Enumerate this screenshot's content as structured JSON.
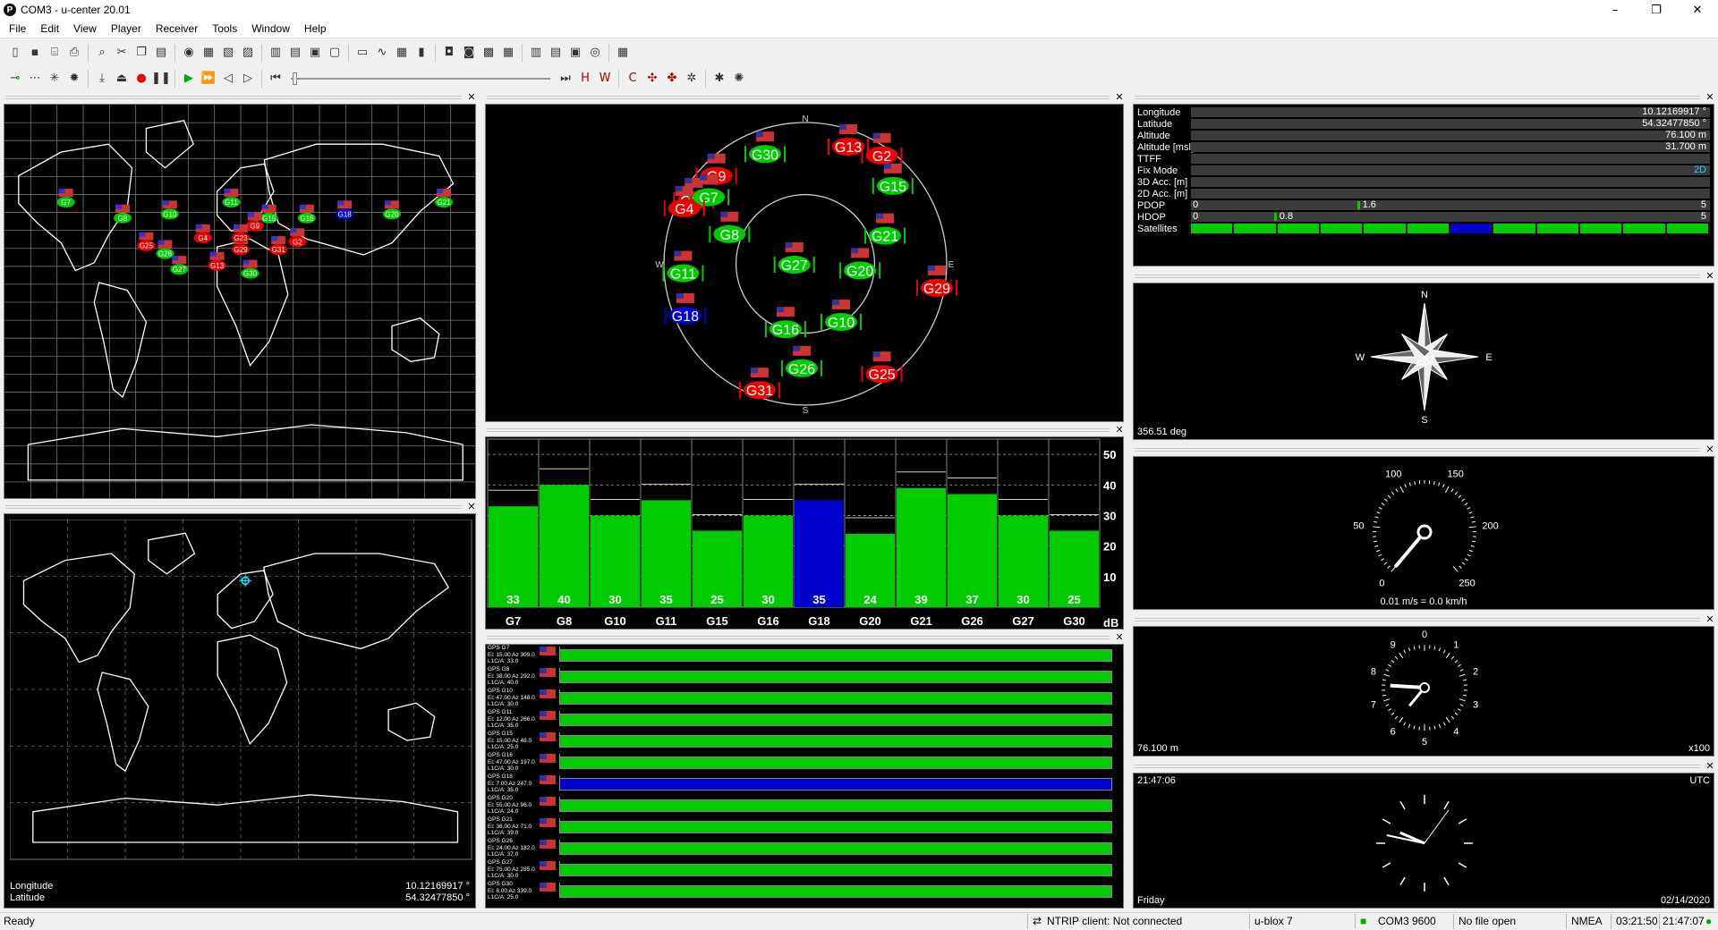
{
  "window": {
    "title": "COM3 - u-center 20.01",
    "app_icon": "P"
  },
  "menu": [
    "File",
    "Edit",
    "View",
    "Player",
    "Receiver",
    "Tools",
    "Window",
    "Help"
  ],
  "toolbar1": [
    "new-icon",
    "save-icon",
    "open-icon",
    "print-icon",
    "preview-icon",
    "cut-icon",
    "copy-icon",
    "paste-icon",
    "record-icon",
    "doc1-icon",
    "doc2-icon",
    "doc3-icon",
    "layout1-icon",
    "layout2-icon",
    "layout3-icon",
    "layout4-icon",
    "chart-icon",
    "graph-icon",
    "table-icon",
    "signal-icon",
    "camera-icon",
    "msg1-icon",
    "msg2-icon",
    "msg3-icon",
    "msg4-icon",
    "msg5-icon",
    "msg6-icon",
    "msg7-icon",
    "msg8-icon"
  ],
  "toolbar2": [
    "connect-icon",
    "baud-icon",
    "autobaud-icon",
    "settings-icon",
    "download-icon",
    "eject-icon",
    "rec-icon",
    "pause-icon",
    "play-icon",
    "fast-icon",
    "back-icon",
    "step-fwd-icon",
    "step-back-icon",
    "end-icon",
    "h-icon",
    "w-icon",
    "c-icon",
    "gnss1-icon",
    "gnss2-icon",
    "cfg1-icon",
    "cfg2-icon",
    "cfg3-icon"
  ],
  "map1": {
    "satellites": [
      "G7",
      "G8",
      "G10",
      "G11",
      "G15",
      "G16",
      "G18",
      "G20",
      "G21",
      "G26",
      "G27",
      "G29",
      "G30",
      "G31",
      "G9",
      "G13",
      "G2",
      "G23",
      "G4",
      "G25"
    ]
  },
  "map2": {
    "longitude_label": "Longitude",
    "longitude": "10.12169917 °",
    "latitude_label": "Latitude",
    "latitude": "54.32477850 °"
  },
  "sky": {
    "north": "N",
    "east": "E",
    "south": "S",
    "west": "W",
    "sats": [
      {
        "id": "G30",
        "az": 340,
        "el": 15,
        "color": "#0c0"
      },
      {
        "id": "G13",
        "az": 20,
        "el": 10,
        "color": "#e00"
      },
      {
        "id": "G2",
        "az": 35,
        "el": 5,
        "color": "#e00"
      },
      {
        "id": "G9",
        "az": 315,
        "el": 10,
        "color": "#e00"
      },
      {
        "id": "G23",
        "az": 300,
        "el": 8,
        "color": "#e00"
      },
      {
        "id": "G7",
        "az": 305,
        "el": 15,
        "color": "#0c0"
      },
      {
        "id": "G4",
        "az": 295,
        "el": 5,
        "color": "#e00"
      },
      {
        "id": "G15",
        "az": 48,
        "el": 15,
        "color": "#0c0"
      },
      {
        "id": "G8",
        "az": 292,
        "el": 38,
        "color": "#0c0"
      },
      {
        "id": "G21",
        "az": 70,
        "el": 36,
        "color": "#0c0"
      },
      {
        "id": "G27",
        "az": 270,
        "el": 83,
        "color": "#0c0"
      },
      {
        "id": "G20",
        "az": 96,
        "el": 55,
        "color": "#0c0"
      },
      {
        "id": "G11",
        "az": 266,
        "el": 12,
        "color": "#0c0"
      },
      {
        "id": "G29",
        "az": 100,
        "el": 5,
        "color": "#e00"
      },
      {
        "id": "G18",
        "az": 247,
        "el": 7,
        "color": "#00c"
      },
      {
        "id": "G10",
        "az": 148,
        "el": 47,
        "color": "#0c0"
      },
      {
        "id": "G16",
        "az": 197,
        "el": 47,
        "color": "#0c0"
      },
      {
        "id": "G26",
        "az": 182,
        "el": 24,
        "color": "#0c0"
      },
      {
        "id": "G25",
        "az": 145,
        "el": 5,
        "color": "#e00"
      },
      {
        "id": "G31",
        "az": 200,
        "el": 5,
        "color": "#e00"
      }
    ]
  },
  "chart_data": {
    "type": "bar",
    "categories": [
      "G7",
      "G8",
      "G10",
      "G11",
      "G15",
      "G16",
      "G18",
      "G20",
      "G21",
      "G26",
      "G27",
      "G30"
    ],
    "values": [
      33,
      40,
      30,
      35,
      25,
      30,
      35,
      24,
      39,
      37,
      30,
      25
    ],
    "colors": [
      "#0c0",
      "#0c0",
      "#0c0",
      "#0c0",
      "#0c0",
      "#0c0",
      "#00c",
      "#0c0",
      "#0c0",
      "#0c0",
      "#0c0",
      "#0c0"
    ],
    "yticks": [
      10,
      20,
      30,
      40,
      50
    ],
    "unit": "dB",
    "ylim": [
      0,
      55
    ]
  },
  "sigtable": [
    {
      "l1": "GPS G7",
      "l2": "El: 15.00 Az 309.0",
      "l3": "L1C/A: 33.0",
      "color": "#0c0"
    },
    {
      "l1": "GPS G8",
      "l2": "El: 38.00 Az 292.0",
      "l3": "L1C/A: 40.0",
      "color": "#0c0"
    },
    {
      "l1": "GPS G10",
      "l2": "El: 47.00 Az 148.0",
      "l3": "L1C/A: 30.0",
      "color": "#0c0"
    },
    {
      "l1": "GPS G11",
      "l2": "El: 12.00 Az 266.0",
      "l3": "L1C/A: 35.0",
      "color": "#0c0"
    },
    {
      "l1": "GPS G15",
      "l2": "El: 15.00 Az 48.0",
      "l3": "L1C/A: 25.0",
      "color": "#0c0"
    },
    {
      "l1": "GPS G16",
      "l2": "El: 47.00 Az 197.0",
      "l3": "L1C/A: 30.0",
      "color": "#0c0"
    },
    {
      "l1": "GPS G18",
      "l2": "El: 7.00 Az 247.0",
      "l3": "L1C/A: 35.0",
      "color": "#00c"
    },
    {
      "l1": "GPS G20",
      "l2": "El: 55.00 Az 96.0",
      "l3": "L1C/A: 24.0",
      "color": "#0c0"
    },
    {
      "l1": "GPS G21",
      "l2": "El: 36.00 Az 71.0",
      "l3": "L1C/A: 39.0",
      "color": "#0c0"
    },
    {
      "l1": "GPS G26",
      "l2": "El: 24.00 Az 182.0",
      "l3": "L1C/A: 37.0",
      "color": "#0c0"
    },
    {
      "l1": "GPS G27",
      "l2": "El: 75.00 Az 285.0",
      "l3": "L1C/A: 30.0",
      "color": "#0c0"
    },
    {
      "l1": "GPS G30",
      "l2": "El: 8.00 Az 339.0",
      "l3": "L1C/A: 25.0",
      "color": "#0c0"
    }
  ],
  "data": {
    "longitude_label": "Longitude",
    "longitude": "10.12169917 °",
    "latitude_label": "Latitude",
    "latitude": "54.32477850 °",
    "altitude_label": "Altitude",
    "altitude": "76.100 m",
    "altitude_msl_label": "Altitude [msl]",
    "altitude_msl": "31.700 m",
    "ttff_label": "TTFF",
    "ttff": "",
    "fixmode_label": "Fix Mode",
    "fixmode": "2D",
    "acc3d_label": "3D Acc. [m]",
    "acc3d": "",
    "acc2d_label": "2D Acc. [m]",
    "acc2d": "",
    "pdop_label": "PDOP",
    "pdop_min": "0",
    "pdop": "1.6",
    "pdop_max": "5",
    "pdop_fraction": 0.32,
    "hdop_label": "HDOP",
    "hdop_min": "0",
    "hdop": "0.8",
    "hdop_max": "5",
    "hdop_fraction": 0.16,
    "satellites_label": "Satellites",
    "satellite_colors": [
      "#0c0",
      "#0c0",
      "#0c0",
      "#0c0",
      "#0c0",
      "#0c0",
      "#00c",
      "#0c0",
      "#0c0",
      "#0c0",
      "#0c0",
      "#0c0"
    ]
  },
  "compass": {
    "n": "N",
    "e": "E",
    "s": "S",
    "w": "W",
    "heading": "356.51 deg"
  },
  "speedo": {
    "ticks": [
      "0",
      "50",
      "100",
      "150",
      "200",
      "250"
    ],
    "reading": "0.01 m/s = 0.0 km/h"
  },
  "altimeter": {
    "ticks": [
      "0",
      "1",
      "2",
      "3",
      "4",
      "5",
      "6",
      "7",
      "8",
      "9"
    ],
    "reading": "76.100 m",
    "scale": "x100"
  },
  "clock": {
    "time": "21:47:06",
    "zone": "UTC",
    "day": "Friday",
    "date": "02/14/2020"
  },
  "status": {
    "ready": "Ready",
    "ntrip": "NTRIP client: Not connected",
    "receiver": "u-blox 7",
    "port": "COM3 9600",
    "file": "No file open",
    "protocol": "NMEA",
    "elapsed": "03:21:50",
    "clock": "21:47:07"
  }
}
